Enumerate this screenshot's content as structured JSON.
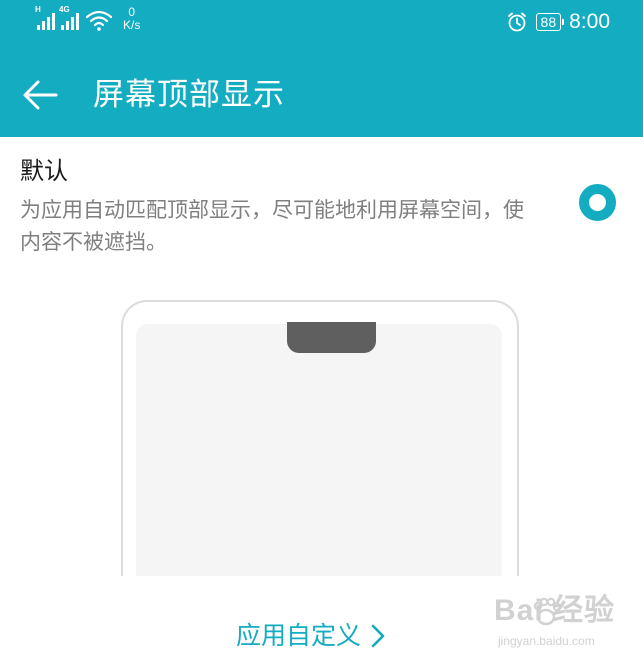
{
  "status_bar": {
    "network_1_tag": "H",
    "network_2_tag": "4G",
    "speed_value": "0",
    "speed_unit": "K/s",
    "battery_level": "88",
    "time": "8:00",
    "icons": [
      "signal-icon",
      "signal-icon",
      "wifi-icon",
      "alarm-icon",
      "battery-icon"
    ]
  },
  "app_bar": {
    "back_icon": "arrow-left-icon",
    "title": "屏幕顶部显示"
  },
  "option_default": {
    "title": "默认",
    "description": "为应用自动匹配顶部显示，尽可能地利用屏幕空间，使内容不被遮挡。",
    "selected": true
  },
  "link": {
    "label": "应用自定义",
    "icon": "chevron-right-icon"
  },
  "watermark": {
    "logo": "Bai 经验",
    "site": "jingyan.baidu.com"
  },
  "colors": {
    "accent": "#14acc0",
    "header_bg": "#14acc0",
    "title_text": "#1a1a1a",
    "description_text": "#7f7f7f",
    "phone_outline": "#dcdcdc",
    "phone_screen": "#f5f5f5",
    "notch": "#5f5f5f"
  }
}
